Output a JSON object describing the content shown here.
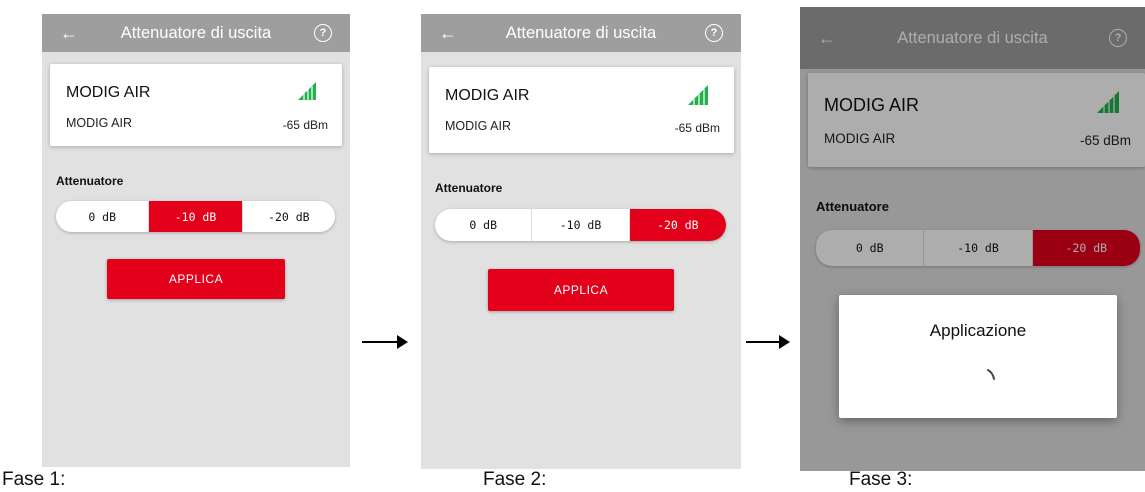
{
  "app": {
    "title": "Attenuatore di uscita",
    "back_icon": "arrow-left-icon",
    "help_icon": "help-circle-icon",
    "help_glyph": "?"
  },
  "device": {
    "name": "MODIG AIR",
    "subtitle": "MODIG AIR",
    "rssi": "-65 dBm",
    "signal_icon": "signal-strength-icon",
    "signal_color": "#22b14c"
  },
  "attenuator": {
    "label": "Attenuatore",
    "options": [
      "0 dB",
      "-10 dB",
      "-20 dB"
    ]
  },
  "apply_label": "APPLICA",
  "dialog": {
    "title": "Applicazione"
  },
  "colors": {
    "accent": "#e3001b",
    "appbar": "#9e9e9e",
    "background": "#e1e1e1"
  },
  "steps": [
    {
      "caption": "Fase 1:",
      "selected": "-10 dB"
    },
    {
      "caption": "Fase 2:",
      "selected": "-20 dB"
    },
    {
      "caption": "Fase 3:",
      "selected": "-20 dB"
    }
  ]
}
